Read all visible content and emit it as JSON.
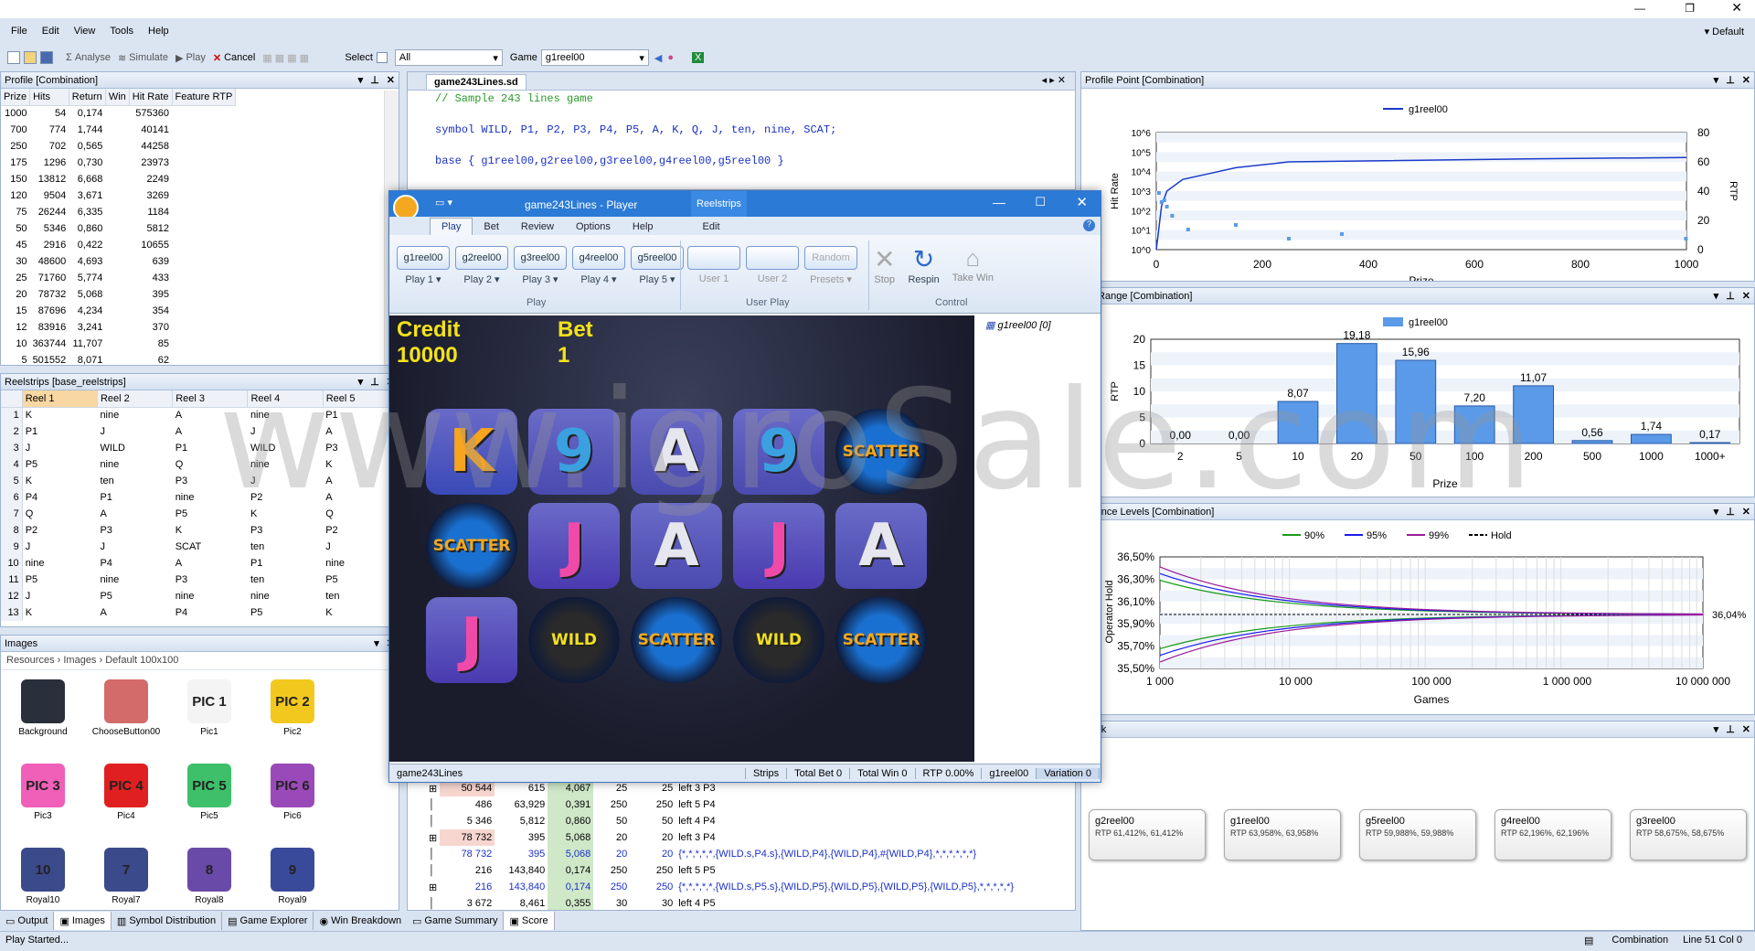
{
  "menu": [
    "File",
    "Edit",
    "View",
    "Tools",
    "Help"
  ],
  "window": {
    "default_label": "Default"
  },
  "toolbar": {
    "analyse": "Analyse",
    "simulate": "Simulate",
    "play": "Play",
    "cancel": "Cancel",
    "select": "Select",
    "select_value": "All",
    "game": "Game",
    "game_value": "g1reel00"
  },
  "profile": {
    "title": "Profile [Combination]",
    "headers": [
      "Prize",
      "Hits",
      "Return",
      "Win",
      "Hit Rate",
      "Feature RTP"
    ],
    "rows": [
      [
        "1000",
        "54",
        "0,174",
        "",
        "575360",
        ""
      ],
      [
        "700",
        "774",
        "1,744",
        "",
        "40141",
        ""
      ],
      [
        "250",
        "702",
        "0,565",
        "",
        "44258",
        ""
      ],
      [
        "175",
        "1296",
        "0,730",
        "",
        "23973",
        ""
      ],
      [
        "150",
        "13812",
        "6,668",
        "",
        "2249",
        ""
      ],
      [
        "120",
        "9504",
        "3,671",
        "",
        "3269",
        ""
      ],
      [
        "75",
        "26244",
        "6,335",
        "",
        "1184",
        ""
      ],
      [
        "50",
        "5346",
        "0,860",
        "",
        "5812",
        ""
      ],
      [
        "45",
        "2916",
        "0,422",
        "",
        "10655",
        ""
      ],
      [
        "30",
        "48600",
        "4,693",
        "",
        "639",
        ""
      ],
      [
        "25",
        "71760",
        "5,774",
        "",
        "433",
        ""
      ],
      [
        "20",
        "78732",
        "5,068",
        "",
        "395",
        ""
      ],
      [
        "15",
        "87696",
        "4,234",
        "",
        "354",
        ""
      ],
      [
        "12",
        "83916",
        "3,241",
        "",
        "370",
        ""
      ],
      [
        "10",
        "363744",
        "11,707",
        "",
        "85",
        ""
      ],
      [
        "5",
        "501552",
        "8,071",
        "",
        "62",
        ""
      ]
    ]
  },
  "reelstrips": {
    "title": "Reelstrips [base_reelstrips]",
    "headers": [
      "Reel 1",
      "Reel 2",
      "Reel 3",
      "Reel 4",
      "Reel 5"
    ],
    "rows": [
      [
        "K",
        "nine",
        "A",
        "nine",
        "P1"
      ],
      [
        "P1",
        "J",
        "A",
        "J",
        "A"
      ],
      [
        "J",
        "WILD",
        "P1",
        "WILD",
        "P3"
      ],
      [
        "P5",
        "nine",
        "Q",
        "nine",
        "K"
      ],
      [
        "K",
        "ten",
        "P3",
        "J",
        "A"
      ],
      [
        "P4",
        "P1",
        "nine",
        "P2",
        "A"
      ],
      [
        "Q",
        "A",
        "P5",
        "K",
        "Q"
      ],
      [
        "P2",
        "P3",
        "K",
        "P3",
        "P2"
      ],
      [
        "J",
        "J",
        "SCAT",
        "ten",
        "J"
      ],
      [
        "nine",
        "P4",
        "A",
        "P1",
        "nine"
      ],
      [
        "P5",
        "nine",
        "P3",
        "ten",
        "P5"
      ],
      [
        "J",
        "P5",
        "nine",
        "nine",
        "ten"
      ],
      [
        "K",
        "A",
        "P4",
        "P5",
        "K"
      ]
    ]
  },
  "images": {
    "title": "Images",
    "breadcrumb": [
      "Resources",
      "Images",
      "Default 100x100"
    ],
    "items": [
      {
        "name": "Background",
        "glyph": "",
        "color": "#2a2f3c"
      },
      {
        "name": "ChooseButton00",
        "glyph": "",
        "color": "#d46b6b"
      },
      {
        "name": "Pic1",
        "glyph": "PIC 1",
        "color": "#f4f4f4"
      },
      {
        "name": "Pic2",
        "glyph": "PIC 2",
        "color": "#f2c81e"
      },
      {
        "name": "Pic3",
        "glyph": "PIC 3",
        "color": "#f05fb8"
      },
      {
        "name": "Pic4",
        "glyph": "PIC 4",
        "color": "#e02020"
      },
      {
        "name": "Pic5",
        "glyph": "PIC 5",
        "color": "#3ec06a"
      },
      {
        "name": "Pic6",
        "glyph": "PIC 6",
        "color": "#9a4ab8"
      },
      {
        "name": "Royal10",
        "glyph": "10",
        "color": "#3a4a8a"
      },
      {
        "name": "Royal7",
        "glyph": "7",
        "color": "#3a4a8a"
      },
      {
        "name": "Royal8",
        "glyph": "8",
        "color": "#6a4aa8"
      },
      {
        "name": "Royal9",
        "glyph": "9",
        "color": "#3a4a9a"
      }
    ]
  },
  "editor": {
    "tab": "game243Lines.sd",
    "lines": [
      "// Sample 243 lines game",
      "symbol WILD, P1, P2, P3, P4, P5, A, K, Q, J, ten, nine, SCAT;",
      "base { g1reel00,g2reel00,g3reel00,g4reel00,g5reel00 }"
    ]
  },
  "bottom_table": {
    "rows": [
      [
        "50 544",
        "615",
        "4,067",
        "25",
        "25",
        "left 3 P3"
      ],
      [
        "486",
        "63,929",
        "0,391",
        "250",
        "250",
        "left 5 P4"
      ],
      [
        "5 346",
        "5,812",
        "0,860",
        "50",
        "50",
        "left 4 P4"
      ],
      [
        "78 732",
        "395",
        "5,068",
        "20",
        "20",
        "left 3 P4"
      ],
      [
        "78 732",
        "395",
        "5,068",
        "20",
        "20",
        "{*,*,*,*,*,{WILD.s,P4.s},{WILD,P4},{WILD,P4},#{WILD,P4},*,*,*,*,*,*}"
      ],
      [
        "216",
        "143,840",
        "0,174",
        "250",
        "250",
        "left 5 P5"
      ],
      [
        "216",
        "143,840",
        "0,174",
        "250",
        "250",
        "{*,*,*,*,*,{WILD.s,P5.s},{WILD,P5},{WILD,P5},{WILD,P5},{WILD,P5},*,*,*,*,*}"
      ],
      [
        "3 672",
        "8,461",
        "0,355",
        "30",
        "30",
        "left 4 P5"
      ]
    ]
  },
  "bottom_tabs": [
    "Output",
    "Images",
    "Symbol Distribution",
    "Game Explorer",
    "Win Breakdown"
  ],
  "center_tabs": [
    "Game Summary",
    "Score"
  ],
  "player": {
    "title": "game243Lines - Player",
    "ctx_tab": "Reelstrips",
    "tabs": [
      "Play",
      "Bet",
      "Review",
      "Options",
      "Help"
    ],
    "ctx_sub": "Edit",
    "play_buttons": [
      "g1reel00",
      "g2reel00",
      "g3reel00",
      "g4reel00",
      "g5reel00"
    ],
    "play_labels": [
      "Play 1",
      "Play 2",
      "Play 3",
      "Play 4",
      "Play 5"
    ],
    "group_play": "Play",
    "user_labels": [
      "User 1",
      "User 2",
      "Presets"
    ],
    "random": "Random",
    "group_user": "User Play",
    "control": [
      "Stop",
      "Respin",
      "Take Win"
    ],
    "group_control": "Control",
    "credit_label": "Credit",
    "credit": "10000",
    "bet_label": "Bet",
    "bet": "1",
    "tree_item": "g1reel00 [0]",
    "grid": [
      [
        "K",
        "9",
        "A",
        "9",
        "SCATTER"
      ],
      [
        "SCATTER",
        "J",
        "A",
        "J",
        "A"
      ],
      [
        "J",
        "WILD",
        "SCATTER",
        "WILD",
        "SCATTER"
      ]
    ],
    "status": [
      "game243Lines",
      "Strips",
      "Total Bet 0",
      "Total Win 0",
      "RTP 0.00%",
      "g1reel00",
      "Variation 0"
    ]
  },
  "profile_point": {
    "title": "Profile Point [Combination]",
    "legend": "g1reel00",
    "ylabel": "Hit Rate",
    "y2label": "RTP",
    "xlabel": "Prize"
  },
  "prize_range": {
    "title": "ile Range [Combination]",
    "legend": "g1reel00",
    "ylabel": "RTP",
    "xlabel": "Prize"
  },
  "confidence": {
    "title": "fidence Levels [Combination]",
    "legend": [
      "90%",
      "95%",
      "99%",
      "Hold"
    ],
    "ylabel": "Operator Hold",
    "xlabel": "Games",
    "hold_label": "36,04%"
  },
  "network": {
    "title": "work",
    "nodes": [
      {
        "name": "g2reel00",
        "rtp": "RTP 61,412%, 61,412%"
      },
      {
        "name": "g1reel00",
        "rtp": "RTP 63,958%, 63,958%"
      },
      {
        "name": "g5reel00",
        "rtp": "RTP 59,988%, 59,988%"
      },
      {
        "name": "g4reel00",
        "rtp": "RTP 62,196%, 62,196%"
      },
      {
        "name": "g3reel00",
        "rtp": "RTP 58,675%, 58,675%"
      }
    ]
  },
  "statusbar": {
    "left": "Play Started...",
    "mode": "Combination",
    "pos": "Line 51  Col 0"
  },
  "watermark": "www.igroSale.com",
  "chart_data": [
    {
      "type": "line",
      "title": "",
      "xlabel": "Prize",
      "ylabel": "Hit Rate",
      "y2label": "RTP",
      "xlim": [
        0,
        1000
      ],
      "yticks": [
        "10^0",
        "10^1",
        "10^2",
        "10^3",
        "10^4",
        "10^5",
        "10^6"
      ],
      "y2ticks": [
        0,
        20,
        40,
        60,
        80
      ],
      "series": [
        {
          "name": "g1reel00",
          "x": [
            5,
            10,
            20,
            50,
            100,
            150,
            250,
            700,
            1000
          ],
          "y": [
            15,
            30,
            40,
            48,
            52,
            56,
            60,
            62,
            63
          ]
        }
      ]
    },
    {
      "type": "bar",
      "xlabel": "Prize",
      "ylabel": "RTP",
      "ylim": [
        0,
        20
      ],
      "categories": [
        "2",
        "5",
        "10",
        "20",
        "50",
        "100",
        "200",
        "500",
        "1000",
        "1000+"
      ],
      "series": [
        {
          "name": "g1reel00",
          "values": [
            0.0,
            0.0,
            8.07,
            19.18,
            15.96,
            7.2,
            11.07,
            0.56,
            1.74,
            0.17
          ]
        }
      ],
      "data_labels": [
        "0,00",
        "0,00",
        "8,07",
        "19,18",
        "15,96",
        "7,20",
        "11,07",
        "0,56",
        "1,74",
        "0,17"
      ]
    },
    {
      "type": "line",
      "xlabel": "Games",
      "ylabel": "Operator Hold",
      "yticks": [
        "36,50%",
        "36,30%",
        "36,10%",
        "35,90%",
        "35,70%",
        "35,50%"
      ],
      "xticks": [
        "1 000",
        "10 000",
        "100 000",
        "1 000 000",
        "10 000 000"
      ],
      "series": [
        {
          "name": "90%",
          "color": "#1a9a1a"
        },
        {
          "name": "95%",
          "color": "#1a1aee"
        },
        {
          "name": "99%",
          "color": "#9a1a9a"
        },
        {
          "name": "Hold",
          "color": "#000000"
        }
      ]
    }
  ]
}
